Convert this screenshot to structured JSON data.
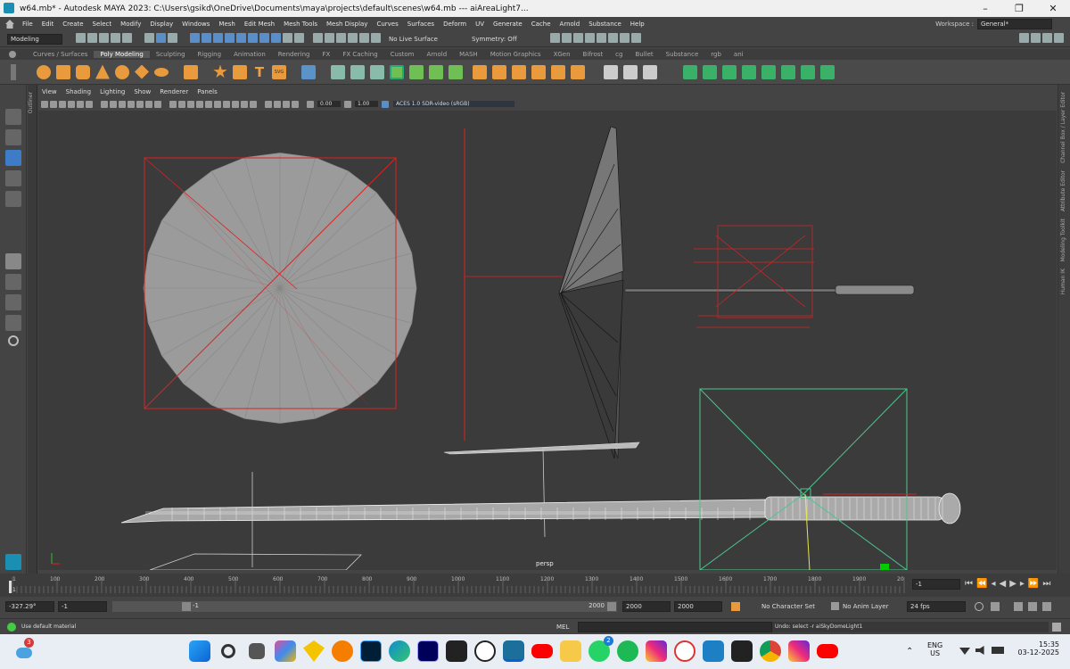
{
  "window": {
    "title": "w64.mb* - Autodesk MAYA 2023: C:\\Users\\gsikd\\OneDrive\\Documents\\maya\\projects\\default\\scenes\\w64.mb   ---   aiAreaLight7...",
    "minimize": "–",
    "maximize": "❐",
    "close": "✕"
  },
  "menus": [
    "File",
    "Edit",
    "Create",
    "Select",
    "Modify",
    "Display",
    "Windows",
    "Mesh",
    "Edit Mesh",
    "Mesh Tools",
    "Mesh Display",
    "Curves",
    "Surfaces",
    "Deform",
    "UV",
    "Generate",
    "Cache",
    "Arnold",
    "Substance",
    "Help"
  ],
  "workspace": {
    "label": "Workspace :",
    "value": "General*"
  },
  "statusline": {
    "menuset": "Modeling",
    "live_surface": "No Live Surface",
    "symmetry": "Symmetry: Off"
  },
  "shelf_tabs": [
    "Curves / Surfaces",
    "Poly Modeling",
    "Sculpting",
    "Rigging",
    "Animation",
    "Rendering",
    "FX",
    "FX Caching",
    "Custom",
    "Arnold",
    "MASH",
    "Motion Graphics",
    "XGen",
    "Bifrost",
    "cg",
    "Bullet",
    "Substance",
    "rgb",
    "ani"
  ],
  "shelf_active": "Poly Modeling",
  "shelf_text_icons": {
    "text": "T",
    "svg": "SVG"
  },
  "panel_menu": [
    "View",
    "Shading",
    "Lighting",
    "Show",
    "Renderer",
    "Panels"
  ],
  "panel_toolbar": {
    "exposure": "0.00",
    "gamma": "1.00",
    "colorspace": "ACES 1.0 SDR-video (sRGB)"
  },
  "side_panels": [
    "Channel Box / Layer Editor",
    "Attribute Editor",
    "Modeling Toolkit",
    "Human IK"
  ],
  "outliner_label": "Outliner",
  "viewport": {
    "camera": "persp"
  },
  "timeline": {
    "ticks": [
      "1",
      "100",
      "200",
      "300",
      "400",
      "500",
      "600",
      "700",
      "800",
      "900",
      "1000",
      "1100",
      "1200",
      "1300",
      "1400",
      "1500",
      "1600",
      "1700",
      "1800",
      "1900",
      "20"
    ],
    "current_frame": "-1",
    "current_marker": "1"
  },
  "range": {
    "start": "-327.29°",
    "anim_start": "-1",
    "range_start": "-1",
    "range_end": "2000",
    "anim_end": "2000",
    "end": "2000",
    "character_set": "No Character Set",
    "anim_layer": "No Anim Layer",
    "fps": "24 fps"
  },
  "command_line": {
    "status": "Use default material",
    "lang": "MEL",
    "result": "Undo: select -r aiSkyDomeLight1"
  },
  "taskbar": {
    "notif_badge": "3",
    "whatsapp_badge": "2",
    "lang_top": "ENG",
    "lang_bottom": "US",
    "time": "15:35",
    "date": "03-12-2025"
  },
  "colors": {
    "accent": "#5a8ec8",
    "red": "#d22",
    "green": "#3a9",
    "mesh": "#9a9a9a"
  }
}
